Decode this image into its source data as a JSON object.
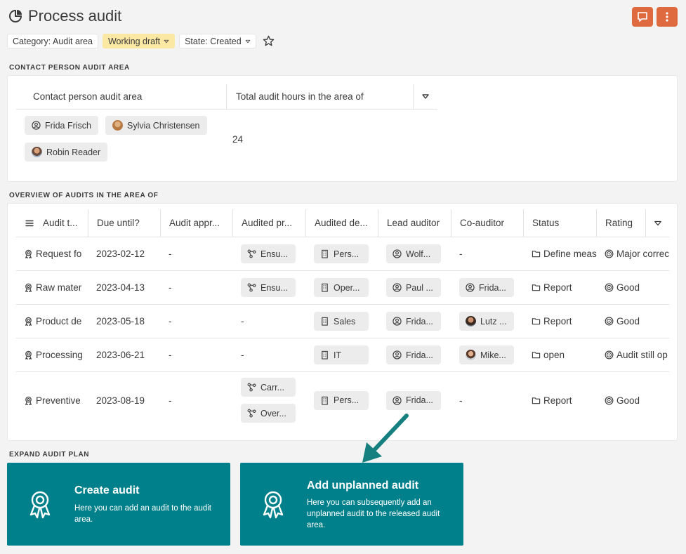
{
  "page": {
    "title": "Process audit"
  },
  "tags": [
    {
      "label": "Category: Audit area",
      "style": "plain",
      "dropdown": false
    },
    {
      "label": "Working draft",
      "style": "yellow",
      "dropdown": true
    },
    {
      "label": "State: Created",
      "style": "plain",
      "dropdown": true
    }
  ],
  "contact_section": {
    "label": "CONTACT PERSON AUDIT AREA",
    "headers": [
      "Contact person audit area",
      "Total audit hours in the area of"
    ],
    "persons": [
      {
        "name": "Frida Frisch",
        "icon": "user-circle-icon"
      },
      {
        "name": "Sylvia Christensen",
        "icon": "avatar-photo"
      },
      {
        "name": "Robin Reader",
        "icon": "avatar-photo"
      }
    ],
    "total_hours": "24"
  },
  "overview_section": {
    "label": "OVERVIEW OF AUDITS IN THE AREA OF",
    "headers": [
      "Audit t...",
      "Due until?",
      "Audit appr...",
      "Audited pr...",
      "Audited de...",
      "Lead auditor",
      "Co-auditor",
      "Status",
      "Rating"
    ],
    "rows": [
      {
        "type": "Request fo",
        "due": "2023-02-12",
        "approval": "-",
        "processes": [
          "Ensu..."
        ],
        "departments": [
          "Pers..."
        ],
        "lead": "Wolf...",
        "co": "-",
        "co_avatar": "",
        "status": "Define meas",
        "rating": "Major correc"
      },
      {
        "type": "Raw mater",
        "due": "2023-04-13",
        "approval": "-",
        "processes": [
          "Ensu..."
        ],
        "departments": [
          "Oper..."
        ],
        "lead": "Paul ...",
        "co": "Frida...",
        "co_avatar": "user",
        "status": "Report",
        "rating": "Good"
      },
      {
        "type": "Product de",
        "due": "2023-05-18",
        "approval": "-",
        "processes": [],
        "departments": [
          "Sales"
        ],
        "lead": "Frida...",
        "co": "Lutz ...",
        "co_avatar": "lutz",
        "status": "Report",
        "rating": "Good"
      },
      {
        "type": "Processing",
        "due": "2023-06-21",
        "approval": "-",
        "processes": [],
        "departments": [
          "IT"
        ],
        "lead": "Frida...",
        "co": "Mike...",
        "co_avatar": "mike",
        "status": "open",
        "rating": "Audit still op"
      },
      {
        "type": "Preventive",
        "due": "2023-08-19",
        "approval": "-",
        "processes": [
          "Carr...",
          "Over..."
        ],
        "departments": [
          "Pers..."
        ],
        "lead": "Frida...",
        "co": "-",
        "co_avatar": "",
        "status": "Report",
        "rating": "Good"
      }
    ]
  },
  "expand_section": {
    "label": "EXPAND AUDIT PLAN",
    "cards": [
      {
        "title": "Create audit",
        "description": "Here you can add an audit to the audit area."
      },
      {
        "title": "Add unplanned audit",
        "description": "Here you can subsequently add an unplanned audit to the released audit area."
      }
    ]
  },
  "colors": {
    "accent": "#00808a",
    "action": "#e06a3f",
    "highlight": "#fae8a3",
    "arrow": "#167f80"
  }
}
